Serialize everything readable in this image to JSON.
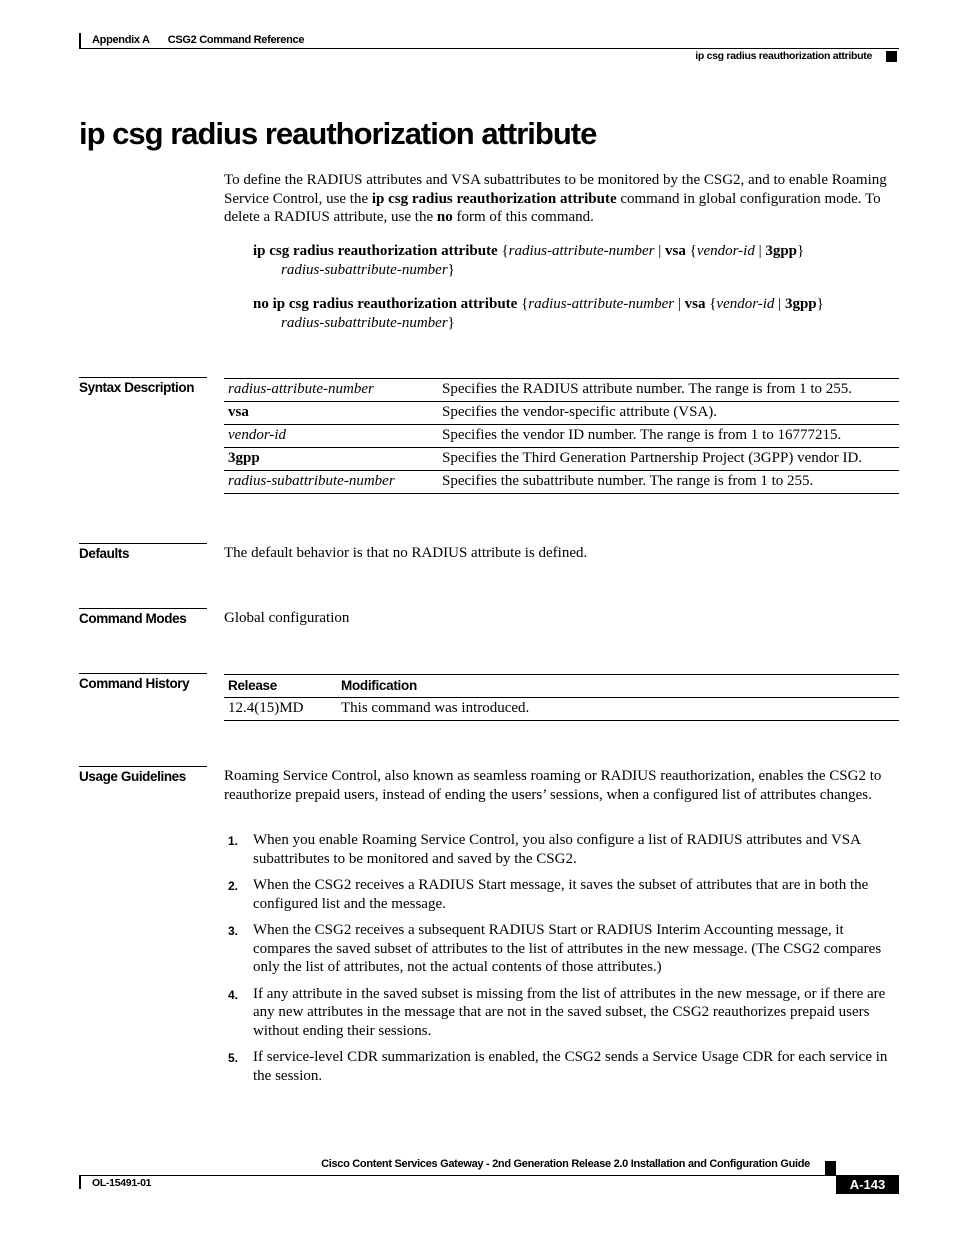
{
  "header": {
    "appendix": "Appendix A",
    "chapter": "CSG2 Command Reference",
    "running_title": "ip csg radius reauthorization attribute"
  },
  "title": "ip csg radius reauthorization attribute",
  "intro": {
    "p1": "To define the RADIUS attributes and VSA subattributes to be monitored by the CSG2, and to enable Roaming Service Control, use the ",
    "cmd": "ip csg radius reauthorization attribute",
    "p2": " command in global configuration mode. To delete a RADIUS attribute, use the ",
    "no": "no",
    "p3": " form of this command."
  },
  "syntax": [
    {
      "command": "ip csg radius reauthorization attribute",
      "open1": " {",
      "arg1": "radius-attribute-number",
      "sep1": " | ",
      "kw1": "vsa",
      "open2": " {",
      "arg2": "vendor-id",
      "sep2": " | ",
      "kw2": "3gpp",
      "close2": "}",
      "arg3": "radius-subattribute-number",
      "close1": "}"
    },
    {
      "command": "no ip csg radius reauthorization attribute",
      "open1": " {",
      "arg1": "radius-attribute-number",
      "sep1": " | ",
      "kw1": "vsa",
      "open2": " {",
      "arg2": "vendor-id",
      "sep2": " | ",
      "kw2": "3gpp",
      "close2": "}",
      "arg3": "radius-subattribute-number",
      "close1": "}"
    }
  ],
  "sections": {
    "syntax_description": "Syntax Description",
    "defaults": "Defaults",
    "command_modes": "Command Modes",
    "command_history": "Command History",
    "usage_guidelines": "Usage Guidelines"
  },
  "syntax_description": [
    {
      "term": "radius-attribute-number",
      "style": "italic",
      "desc": "Specifies the RADIUS attribute number. The range is from 1 to 255."
    },
    {
      "term": "vsa",
      "style": "bold",
      "desc": "Specifies the vendor-specific attribute (VSA)."
    },
    {
      "term": "vendor-id",
      "style": "italic",
      "desc": "Specifies the vendor ID number. The range is from 1 to 16777215."
    },
    {
      "term": "3gpp",
      "style": "bold",
      "desc": "Specifies the Third Generation Partnership Project (3GPP) vendor ID."
    },
    {
      "term": "radius-subattribute-number",
      "style": "italic",
      "desc": "Specifies the subattribute number. The range is from 1 to 255."
    }
  ],
  "defaults": "The default behavior is that no RADIUS attribute is defined.",
  "command_modes": "Global configuration",
  "command_history": {
    "headers": [
      "Release",
      "Modification"
    ],
    "rows": [
      [
        "12.4(15)MD",
        "This command was introduced."
      ]
    ]
  },
  "usage_guidelines": {
    "intro": "Roaming Service Control, also known as seamless roaming or RADIUS reauthorization, enables the CSG2 to reauthorize prepaid users, instead of ending the users’ sessions, when a configured list of attributes changes.",
    "steps": [
      {
        "num": "1.",
        "text": "When you enable Roaming Service Control, you also configure a list of RADIUS attributes and VSA subattributes to be monitored and saved by the CSG2."
      },
      {
        "num": "2.",
        "text": "When the CSG2 receives a RADIUS Start message, it saves the subset of attributes that are in both the configured list and the message."
      },
      {
        "num": "3.",
        "text": "When the CSG2 receives a subsequent RADIUS Start or RADIUS Interim Accounting message, it compares the saved subset of attributes to the list of attributes in the new message. (The CSG2 compares only the list of attributes, not the actual contents of those attributes.)"
      },
      {
        "num": "4.",
        "text": "If any attribute in the saved subset is missing from the list of attributes in the new message, or if there are any new attributes in the message that are not in the saved subset, the CSG2 reauthorizes prepaid users without ending their sessions."
      },
      {
        "num": "5.",
        "text": "If service-level CDR summarization is enabled, the CSG2 sends a Service Usage CDR for each service in the session."
      }
    ]
  },
  "footer": {
    "guide_title": "Cisco Content Services Gateway - 2nd Generation Release 2.0 Installation and Configuration Guide",
    "doc_number": "OL-15491-01",
    "page": "A-143"
  }
}
